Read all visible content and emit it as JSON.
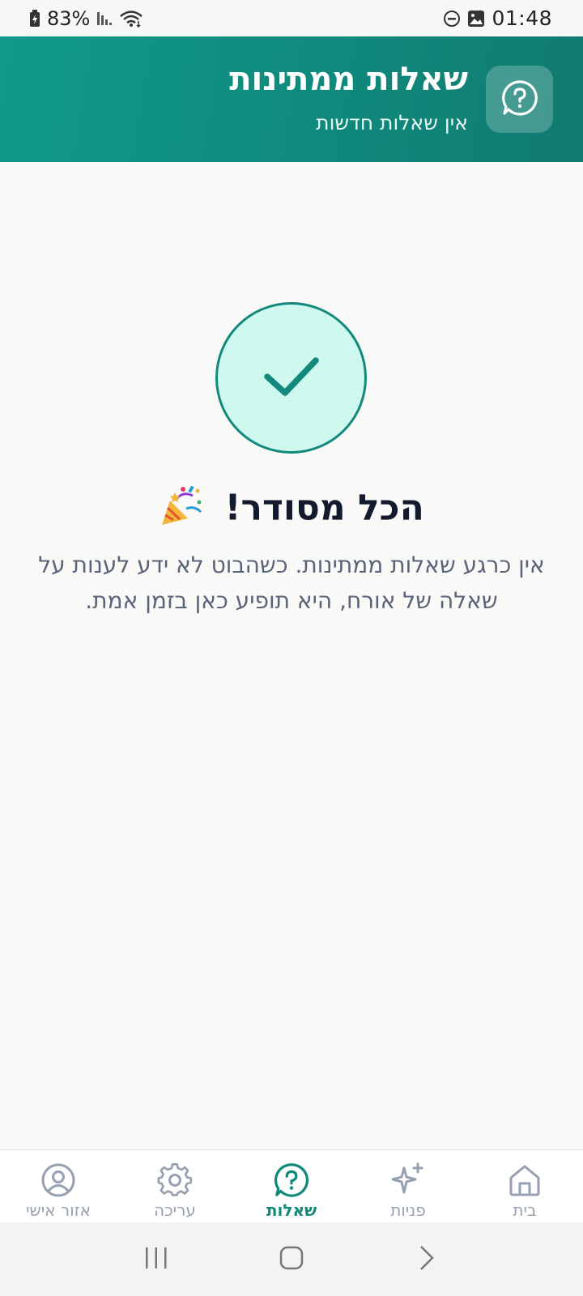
{
  "status_bar": {
    "battery": "83%",
    "time": "01:48"
  },
  "header": {
    "title": "שאלות ממתינות",
    "subtitle": "אין שאלות חדשות",
    "icon": "help-circle-icon"
  },
  "empty_state": {
    "icon": "check-icon",
    "title": "הכל מסודר!",
    "title_emoji": "party-popper-icon",
    "description": "אין כרגע שאלות ממתינות. כשהבוט לא ידע לענות על שאלה של אורח, היא תופיע כאן בזמן אמת."
  },
  "nav": {
    "items": [
      {
        "label": "אזור אישי",
        "icon": "user-circle-icon",
        "active": false
      },
      {
        "label": "עריכה",
        "icon": "gear-icon",
        "active": false
      },
      {
        "label": "שאלות",
        "icon": "help-chat-icon",
        "active": true
      },
      {
        "label": "פניות",
        "icon": "sparkle-icon",
        "active": false
      },
      {
        "label": "בית",
        "icon": "home-icon",
        "active": false
      }
    ]
  },
  "colors": {
    "accent": "#13897c",
    "header_start": "#0f9a8b",
    "header_end": "#117a6f",
    "check_bg": "#cff8ef",
    "inactive": "#97a0b0"
  }
}
